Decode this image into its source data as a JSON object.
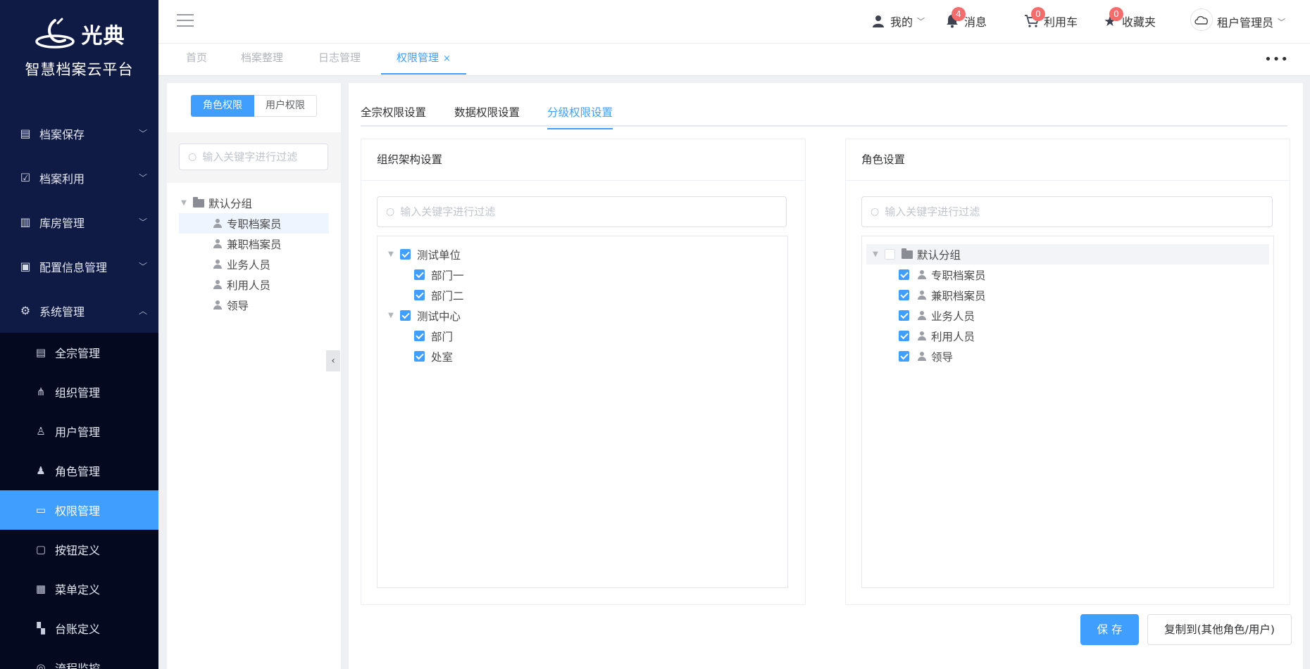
{
  "app": {
    "logo_text": "光典",
    "subtitle": "智慧档案云平台"
  },
  "sidebar": {
    "menu": [
      {
        "label": "档案保存",
        "icon": "archive-icon",
        "expanded": false
      },
      {
        "label": "档案利用",
        "icon": "clipboard-check-icon",
        "expanded": false
      },
      {
        "label": "库房管理",
        "icon": "warehouse-icon",
        "expanded": false
      },
      {
        "label": "配置信息管理",
        "icon": "config-icon",
        "expanded": false
      },
      {
        "label": "系统管理",
        "icon": "gear-icon",
        "expanded": true
      }
    ],
    "submenu": [
      {
        "label": "全宗管理",
        "icon": "document-icon"
      },
      {
        "label": "组织管理",
        "icon": "org-chart-icon"
      },
      {
        "label": "用户管理",
        "icon": "user-outline-icon"
      },
      {
        "label": "角色管理",
        "icon": "user-solid-icon"
      },
      {
        "label": "权限管理",
        "icon": "folder-open-icon",
        "active": true
      },
      {
        "label": "按钮定义",
        "icon": "button-icon"
      },
      {
        "label": "菜单定义",
        "icon": "grid-icon"
      },
      {
        "label": "台账定义",
        "icon": "dashboard-icon"
      },
      {
        "label": "流程监控",
        "icon": "monitor-icon"
      }
    ]
  },
  "header": {
    "mine": "我的",
    "messages": {
      "label": "消息",
      "count": "4"
    },
    "cart": {
      "label": "利用车",
      "count": "0"
    },
    "favorites": {
      "label": "收藏夹",
      "count": "0"
    },
    "user": "租户管理员"
  },
  "tabs": [
    {
      "label": "首页"
    },
    {
      "label": "档案整理"
    },
    {
      "label": "日志管理"
    },
    {
      "label": "权限管理",
      "active": true,
      "close": "×"
    }
  ],
  "left_panel": {
    "seg_role": "角色权限",
    "seg_user": "用户权限",
    "filter_placeholder": "输入关键字进行过滤",
    "tree_root": "默认分组",
    "tree_items": [
      "专职档案员",
      "兼职档案员",
      "业务人员",
      "利用人员",
      "领导"
    ]
  },
  "main": {
    "tabs": [
      "全宗权限设置",
      "数据权限设置",
      "分级权限设置"
    ],
    "active_tab": "分级权限设置",
    "org_card": {
      "title": "组织架构设置",
      "placeholder": "输入关键字进行过滤",
      "tree": [
        {
          "label": "测试单位",
          "children": [
            "部门一",
            "部门二"
          ]
        },
        {
          "label": "测试中心",
          "children": [
            "部门",
            "处室"
          ]
        }
      ]
    },
    "role_card": {
      "title": "角色设置",
      "placeholder": "输入关键字进行过滤",
      "group": "默认分组",
      "items": [
        "专职档案员",
        "兼职档案员",
        "业务人员",
        "利用人员",
        "领导"
      ]
    },
    "save_button": "保 存",
    "copy_button": "复制到(其他角色/用户)"
  },
  "colors": {
    "sidebar_bg": "#0f1a45",
    "submenu_bg": "#04091f",
    "accent": "#409eff",
    "badge": "#f56c6c"
  }
}
